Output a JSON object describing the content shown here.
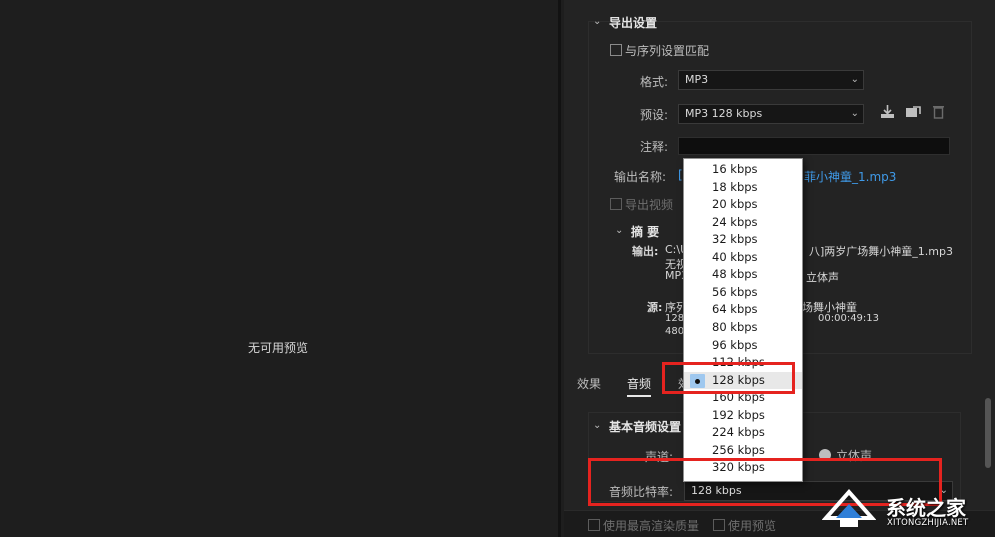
{
  "preview": {
    "no_preview": "无可用预览"
  },
  "export_settings": {
    "title": "导出设置",
    "match_sequence": "与序列设置匹配",
    "format_label": "格式:",
    "format_value": "MP3",
    "preset_label": "预设:",
    "preset_value": "MP3 128 kbps",
    "comment_label": "注释:",
    "output_name_label": "输出名称:",
    "output_name_prefix": "[",
    "output_name_value": "菲小神童_1.mp3",
    "export_video": "导出视频"
  },
  "summary": {
    "title": "摘 要",
    "output_label": "输出:",
    "output_line1_a": "C:\\U",
    "output_line1_b": "八]两岁广场舞小神童_1.mp3",
    "output_line2": "无视",
    "output_line3_a": "MP3",
    "output_line3_b": "立体声",
    "source_label": "源:",
    "source_line1_a": "序列",
    "source_line1_b": "场舞小神童",
    "source_line2_a": "1280",
    "source_line2_b": "00:00:49:13",
    "source_line3_a": "4800"
  },
  "tabs": [
    {
      "label": "效果"
    },
    {
      "label": "音频"
    },
    {
      "label": "效"
    }
  ],
  "audio": {
    "basic_title": "基本音频设置",
    "channel_label": "声道:",
    "channel_option": "立体声",
    "bitrate_label": "音频比特率:",
    "bitrate_value": "128 kbps"
  },
  "bitrate_options": [
    "16 kbps",
    "18 kbps",
    "20 kbps",
    "24 kbps",
    "32 kbps",
    "40 kbps",
    "48 kbps",
    "56 kbps",
    "64 kbps",
    "80 kbps",
    "96 kbps",
    "112 kbps",
    "128 kbps",
    "160 kbps",
    "192 kbps",
    "224 kbps",
    "256 kbps",
    "320 kbps"
  ],
  "bitrate_selected": "128 kbps",
  "bottom": {
    "max_render": "使用最高渲染质量",
    "use_preview": "使用预览"
  },
  "watermark": {
    "name": "系统之家",
    "url": "XITONGZHIJIA.NET"
  },
  "colors": {
    "highlight": "#e5231f",
    "link": "#3f9ae8",
    "selected_bullet": "#9fc8ef"
  }
}
